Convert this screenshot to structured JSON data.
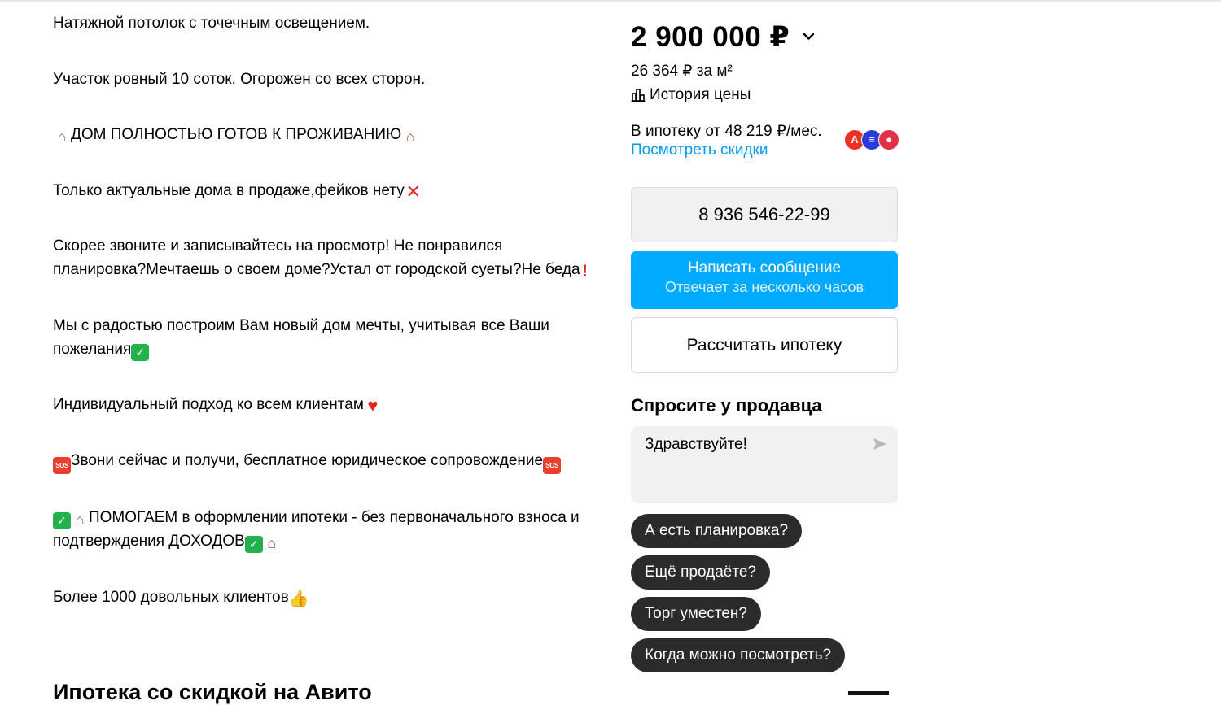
{
  "description": {
    "p1": "Натяжной потолок с точечным освещением.",
    "p2": "Участок ровный 10 соток. Огорожен со всех сторон.",
    "p3": "ДОМ ПОЛНОСТЬЮ ГОТОВ К ПРОЖИВАНИЮ",
    "p4": "Только актуальные дома в продаже,фейков нету",
    "p5": "Скорее звоните и записывайтесь на просмотр! Не понравился планировка?Мечтаешь о своем доме?Устал от городской суеты?Не беда",
    "p6": "Мы с радостью построим Вам новый дом мечты, учитывая все Ваши пожелания",
    "p7": "Индивидуальный подход ко всем клиентам",
    "p8": "Звони сейчас и получи, бесплатное юридическое сопровождение",
    "p9": "ПОМОГАЕМ в оформлении ипотеки - без первоначального взноса и подтверждения ДОХОДОВ",
    "p10": "Более 1000 довольных клиентов"
  },
  "section_heading": "Ипотека со скидкой на Авито",
  "sidebar": {
    "price": "2 900 000 ₽",
    "price_per_m2": "26 364 ₽ за м²",
    "price_history": "История цены",
    "mortgage_from": "В ипотеку от 48 219 ₽/мес.",
    "see_discounts": "Посмотреть скидки",
    "banks": [
      "А",
      "≡",
      "●"
    ],
    "phone": "8 936 546-22-99",
    "message_button": "Написать сообщение",
    "message_sub": "Отвечает за несколько часов",
    "mortgage_button": "Рассчитать ипотеку",
    "ask_title": "Спросите у продавца",
    "ask_text": "Здравствуйте!",
    "quick_questions": [
      "А есть планировка?",
      "Ещё продаёте?",
      "Торг уместен?",
      "Когда можно посмотреть?"
    ]
  },
  "colors": {
    "link": "#0099f7",
    "primary_button": "#00aaff",
    "chip_bg": "#2b2b2b",
    "bank_alfa": "#ef3124",
    "bank_2": "#2a3bdb",
    "bank_3": "#e42f47"
  },
  "icons": [
    "house-emoji",
    "cross-mark-emoji",
    "check-mark-emoji",
    "heart-emoji",
    "sos-emoji",
    "exclamation-emoji",
    "thumbs-up-emoji",
    "chevron-down-icon",
    "chart-icon",
    "send-icon"
  ]
}
